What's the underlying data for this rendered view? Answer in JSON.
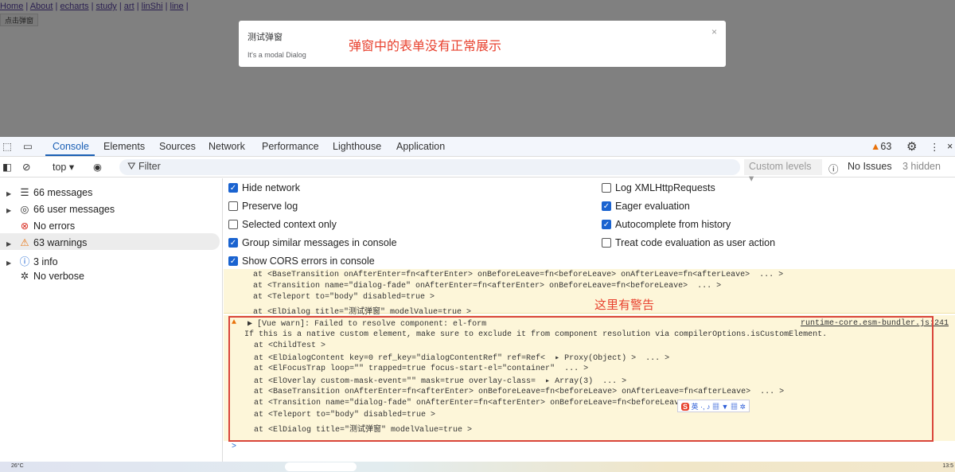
{
  "page": {
    "nav": [
      "Home",
      "About",
      "echarts",
      "study",
      "art",
      "linShi",
      "line"
    ],
    "open_button": "点击弹窗"
  },
  "modal": {
    "title": "测试弹窗",
    "body": "It's a modal Dialog",
    "close": "×",
    "annotation": "弹窗中的表单没有正常展示"
  },
  "devtools": {
    "tabs": [
      "Console",
      "Elements",
      "Sources",
      "Network",
      "Performance",
      "Lighthouse",
      "Application"
    ],
    "warning_count": "63",
    "toolbar": {
      "context": "top ▾",
      "filter_placeholder": "Filter",
      "levels": "Custom levels ▾",
      "issues": "No Issues",
      "hidden": "3 hidden"
    },
    "sidebar": [
      {
        "label": "66 messages",
        "icon": "list-icon"
      },
      {
        "label": "66 user messages",
        "icon": "user-icon"
      },
      {
        "label": "No errors",
        "icon": "error-icon"
      },
      {
        "label": "63 warnings",
        "icon": "warning-icon"
      },
      {
        "label": "3 info",
        "icon": "info-icon"
      },
      {
        "label": "No verbose",
        "icon": "bug-icon"
      }
    ],
    "settings_left": [
      {
        "label": "Hide network",
        "checked": true
      },
      {
        "label": "Preserve log",
        "checked": false
      },
      {
        "label": "Selected context only",
        "checked": false
      },
      {
        "label": "Group similar messages in console",
        "checked": true
      },
      {
        "label": "Show CORS errors in console",
        "checked": true
      }
    ],
    "settings_right": [
      {
        "label": "Log XMLHttpRequests",
        "checked": false
      },
      {
        "label": "Eager evaluation",
        "checked": true
      },
      {
        "label": "Autocomplete from history",
        "checked": true
      },
      {
        "label": "Treat code evaluation as user action",
        "checked": false
      }
    ],
    "prev_warning_lines": [
      "at <BaseTransition onAfterEnter=fn<afterEnter> onBeforeLeave=fn<beforeLeave> onAfterLeave=fn<afterLeave>  ... >",
      "at <Transition name=\"dialog-fade\" onAfterEnter=fn<afterEnter> onBeforeLeave=fn<beforeLeave>  ... >",
      "at <Teleport to=\"body\" disabled=true >",
      "at <ElDialog title=\"测试弹窗\" modelValue=true >"
    ],
    "annotation": "这里有警告",
    "warning": {
      "header": "▶ [Vue warn]: Failed to resolve component: el-form",
      "source": "runtime-core.esm-bundler.js:241",
      "lines": [
        "If this is a native custom element, make sure to exclude it from component resolution via compilerOptions.isCustomElement.",
        "  at <ChildTest >",
        "  at <ElDialogContent key=0 ref_key=\"dialogContentRef\" ref=Ref<  ▸ Proxy(Object) >  ... >",
        "  at <ElFocusTrap loop=\"\" trapped=true focus-start-el=\"container\"  ... >",
        "  at <ElOverlay custom-mask-event=\"\" mask=true overlay-class=  ▸ Array(3)  ... >",
        "  at <BaseTransition onAfterEnter=fn<afterEnter> onBeforeLeave=fn<beforeLeave> onAfterLeave=fn<afterLeave>  ... >",
        "  at <Transition name=\"dialog-fade\" onAfterEnter=fn<afterEnter> onBeforeLeave=fn<beforeLeave>",
        "  at <Teleport to=\"body\" disabled=true >",
        "  at <ElDialog title=\"测试弹窗\" modelValue=true >"
      ]
    },
    "ime_toolbar": {
      "logo": "S",
      "lang": "英"
    },
    "prompt": ">"
  },
  "taskbar": {
    "weather": "26°C",
    "time": "13:5"
  }
}
